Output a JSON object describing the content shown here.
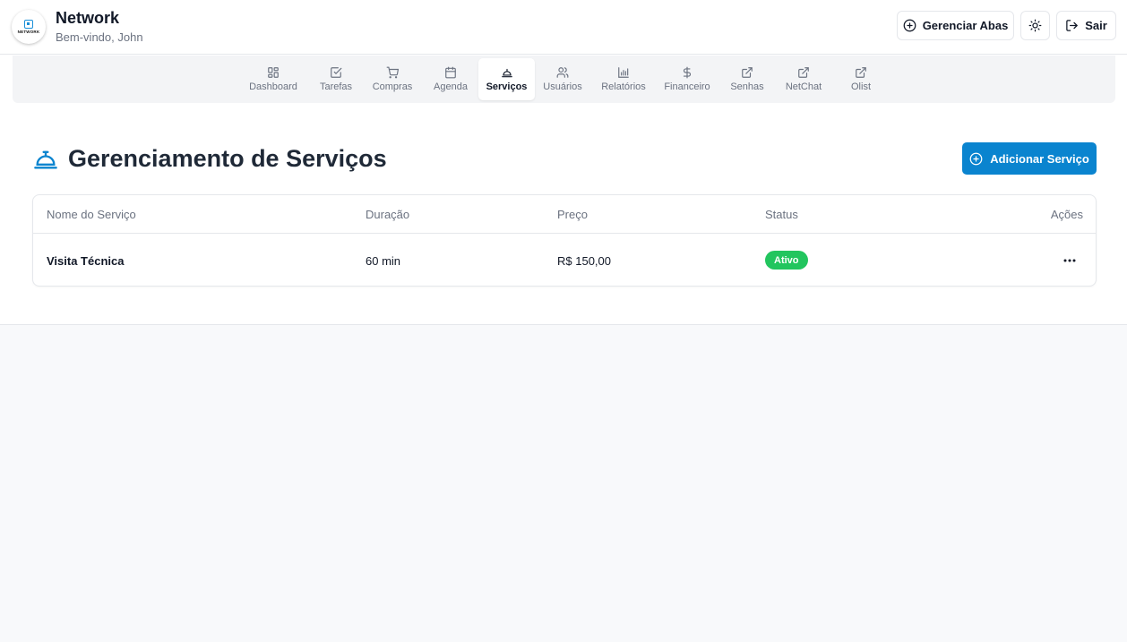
{
  "header": {
    "app_name": "Network",
    "welcome": "Bem-vindo, John",
    "logo_text": "NETWORK",
    "manage_tabs_label": "Gerenciar Abas",
    "theme_icon": "sun-icon",
    "logout_label": "Sair"
  },
  "tabs": [
    {
      "label": "Dashboard",
      "icon": "dashboard-icon"
    },
    {
      "label": "Tarefas",
      "icon": "check-square-icon"
    },
    {
      "label": "Compras",
      "icon": "cart-icon"
    },
    {
      "label": "Agenda",
      "icon": "calendar-icon"
    },
    {
      "label": "Serviços",
      "icon": "bell-concierge-icon",
      "active": true
    },
    {
      "label": "Usuários",
      "icon": "users-icon"
    },
    {
      "label": "Relatórios",
      "icon": "bar-chart-icon"
    },
    {
      "label": "Financeiro",
      "icon": "dollar-icon"
    },
    {
      "label": "Senhas",
      "icon": "external-link-icon"
    },
    {
      "label": "NetChat",
      "icon": "external-link-icon"
    },
    {
      "label": "Olist",
      "icon": "external-link-icon"
    }
  ],
  "page": {
    "title": "Gerenciamento de Serviços",
    "add_button_label": "Adicionar Serviço"
  },
  "table": {
    "columns": [
      "Nome do Serviço",
      "Duração",
      "Preço",
      "Status",
      "Ações"
    ],
    "rows": [
      {
        "name": "Visita Técnica",
        "duration": "60 min",
        "price": "R$ 150,00",
        "status": "Ativo"
      }
    ]
  },
  "colors": {
    "accent": "#0a84cf",
    "status_active": "#22c55e"
  }
}
